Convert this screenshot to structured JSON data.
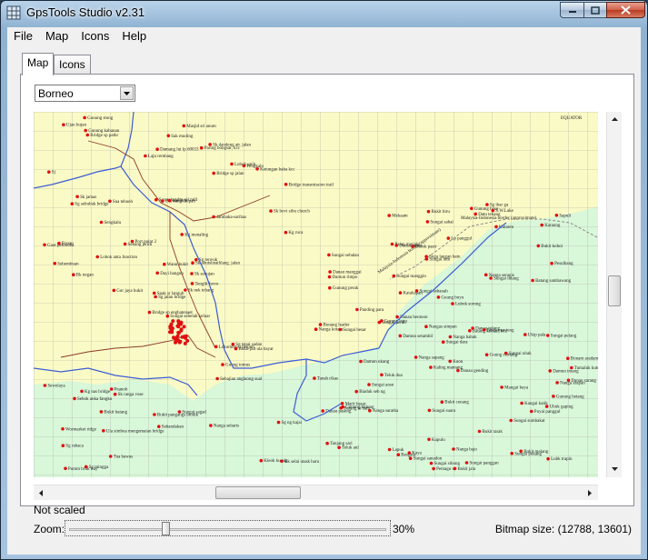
{
  "window": {
    "title": "GpsTools Studio v2.31"
  },
  "menu": [
    "File",
    "Map",
    "Icons",
    "Help"
  ],
  "tabs": [
    {
      "label": "Map",
      "active": true
    },
    {
      "label": "Icons",
      "active": false
    }
  ],
  "map": {
    "region_select": {
      "value": "Borneo"
    },
    "colors": {
      "land_north": "#fafac6",
      "land_south": "#d9f7d9",
      "river": "#3c5dd4",
      "road": "#8b3a26",
      "poi": "#e01010",
      "grid": "#9a9a9a"
    },
    "labels": [
      "Sungai sebelah keluar",
      "Sg sebubuk bridge",
      "Sg jalan bridge",
      "Wormarket ridge",
      "Sk abutsunathlang. jalan",
      "Sk ranga vose",
      "Sk dandeng air. jalan",
      "Mellam",
      "Bridge sp jalan",
      "Sk nek tebang",
      "Bridge sp pathr",
      "Bk selai utask baru",
      "Bk negan",
      "Bridge transmission trail",
      "Bridge sp enghatenaet",
      "Jambaka-saribas",
      "Sg mingga",
      "Saratok palm oil mill",
      "Kg menaling",
      "Kg nas bridge",
      "Port point 2",
      "Sg rahaca",
      "Ula simbua mengemaian bridge",
      "Ula bang dolpah",
      "Sg renyuk",
      "Bukit jait ula bayar",
      "Sk jamas",
      "Damang lut lp 60033",
      "Sebembuan",
      "Lokomotosi benjoh",
      "Kg ruca",
      "Spak sr langub",
      "Bukit pangangs biodik",
      "Dayi bangun",
      "Sua tebaoh",
      "Lubok unik",
      "Peanoh",
      "Kleok ku nig",
      "Sg ng kajai",
      "Sg tapai sadan",
      "Masjid sri anum",
      "Sebang jeridi",
      "Lobok anta Junction",
      "Sebajiau anglaong sual",
      "Tua bawas",
      "Goat pelunuba",
      "Sk sebujan",
      "Pumm bruk tray",
      "Sebandakan",
      "Tenglit fervo",
      "Sebok anka fangku",
      "Sk bovi sibu church",
      "Sj",
      "Guung tomus",
      "Nanga sebaris",
      "Bukit batang",
      "Gunung kabanan",
      "Ujan hujan",
      "Sungai sagad",
      "Ketungan baba kcc",
      "Sak muding",
      "Gur jaya bukit",
      "Ranau",
      "Sengkalu",
      "Pengkalo",
      "Gunung stong",
      "Paring bongsar, kcc",
      "Laju rembang",
      "Wanu bukit",
      "Sewelaya",
      "Sungai suara",
      "Besgata",
      "Mangai baya",
      "Sungai peran",
      "Tanjang sari",
      "Sungai sebalan",
      "Panding para",
      "Tanah rikas",
      "Nangas simpan",
      "Nanga bajo",
      "Nanga babak",
      "Teluk aul",
      "Guung cemang",
      "Gunung betang",
      "Sungai sibung",
      "Sungai pelang",
      "Bukit cenang",
      "Bukit melang",
      "Bukit jala",
      "Bukit tarak",
      "Suga langan batu",
      "Tumaluk kutu, kcc",
      "Bukit manjung",
      "Sungai sumbakat",
      "Sungai dara",
      "Ubuk gaping",
      "Bonang leader",
      "Pemagu ur",
      "Nanga seragis",
      "Sungai intang",
      "Damun ukang",
      "Palan mutiah",
      "Bonam aradam",
      "Nanga kotara",
      "Biaduk seb ng",
      "Nanga saratka",
      "Lapuk",
      "Batang keluan, kcc",
      "Batang sambawang",
      "Damun setambil",
      "Damun intang",
      "Damun rimpo",
      "Guung boyu",
      "Nanga sapang",
      "Danau ranna",
      "Danau paseng",
      "Kaling mamang",
      "Pesulbang",
      "Sungai sebauah",
      "Dolok pasir",
      "Batang ai dam",
      "Bukit kohoi",
      "Lubok sorong",
      "Katahapan",
      "Sungai ubah",
      "Sungai ansu",
      "Lubk trapin",
      "Sungai sanadon",
      "Ukip pala",
      "Gunung perak",
      "Gunung kulung",
      "Sungai panggan",
      "Gurung batu",
      "Sungai manggin",
      "Nanga arapan",
      "Kangai katik",
      "Teluk dua",
      "Marit besar",
      "Danau sarang",
      "Danau bentoon",
      "Danau gending",
      "Sungai besar",
      "Puyai panggul",
      "Kuon",
      "Danau tulung",
      "Danau manggai",
      "Kaya",
      "Sungai pukang",
      "Kapulu",
      "Sungai lum",
      "Sapuli",
      "Bukit biru",
      "Mekaam",
      "Lp panggul",
      "Karaung",
      "Sg ibar ga",
      "Gunung baso",
      "Datu tebang",
      "Sungai sabai",
      "S.W.Lake",
      "Kutaren"
    ],
    "border_labels": [
      "Malaysia-Indonesia border (approximate)",
      "Malaysia-Indonesia border (approximate)"
    ],
    "grid_label": "EQUATOR"
  },
  "status": {
    "scale_text": "Not scaled"
  },
  "zoom": {
    "label": "Zoom:",
    "value_text": "30%",
    "percent": 30
  },
  "bitmap": {
    "text": "Bitmap size: (12788, 13601)"
  }
}
